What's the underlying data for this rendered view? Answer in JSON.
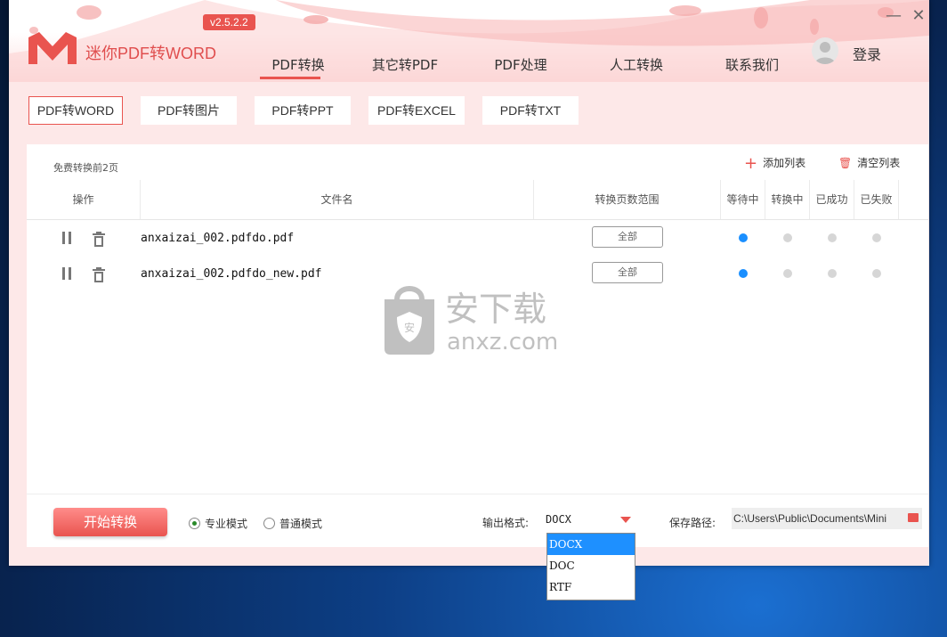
{
  "app": {
    "title": "迷你PDF转WORD",
    "version": "v2.5.2.2",
    "login": "登录"
  },
  "nav": [
    {
      "label": "PDF转换",
      "active": true
    },
    {
      "label": "其它转PDF"
    },
    {
      "label": "PDF处理"
    },
    {
      "label": "人工转换"
    },
    {
      "label": "联系我们"
    }
  ],
  "window_controls": {
    "minimize": "—",
    "close": "✕"
  },
  "subtabs": [
    {
      "label": "PDF转WORD",
      "active": true
    },
    {
      "label": "PDF转图片"
    },
    {
      "label": "PDF转PPT"
    },
    {
      "label": "PDF转EXCEL"
    },
    {
      "label": "PDF转TXT"
    }
  ],
  "panel": {
    "free_note": "免费转换前2页",
    "add_list": "添加列表",
    "clear_list": "清空列表",
    "headers": {
      "ops": "操作",
      "filename": "文件名",
      "range": "转换页数范围",
      "waiting": "等待中",
      "converting": "转换中",
      "success": "已成功",
      "failed": "已失败"
    },
    "rows": [
      {
        "filename": "anxaizai_002.pdfdo.pdf",
        "range": "全部",
        "status": "waiting"
      },
      {
        "filename": "anxaizai_002.pdfdo_new.pdf",
        "range": "全部",
        "status": "waiting"
      }
    ]
  },
  "watermark": {
    "text": "安下载",
    "url": "anxz.com",
    "badge": "安"
  },
  "bottom": {
    "start": "开始转换",
    "mode_pro": "专业模式",
    "mode_normal": "普通模式",
    "output_label": "输出格式:",
    "output_value": "DOCX",
    "save_label": "保存路径:",
    "save_path": "C:\\Users\\Public\\Documents\\Mini"
  },
  "dropdown": {
    "options": [
      "DOCX",
      "DOC",
      "RTF"
    ],
    "selected_index": 0
  },
  "colors": {
    "accent": "#e9544f",
    "waiting_dot": "#1a8fff",
    "idle_dot": "#d6d6d6"
  }
}
